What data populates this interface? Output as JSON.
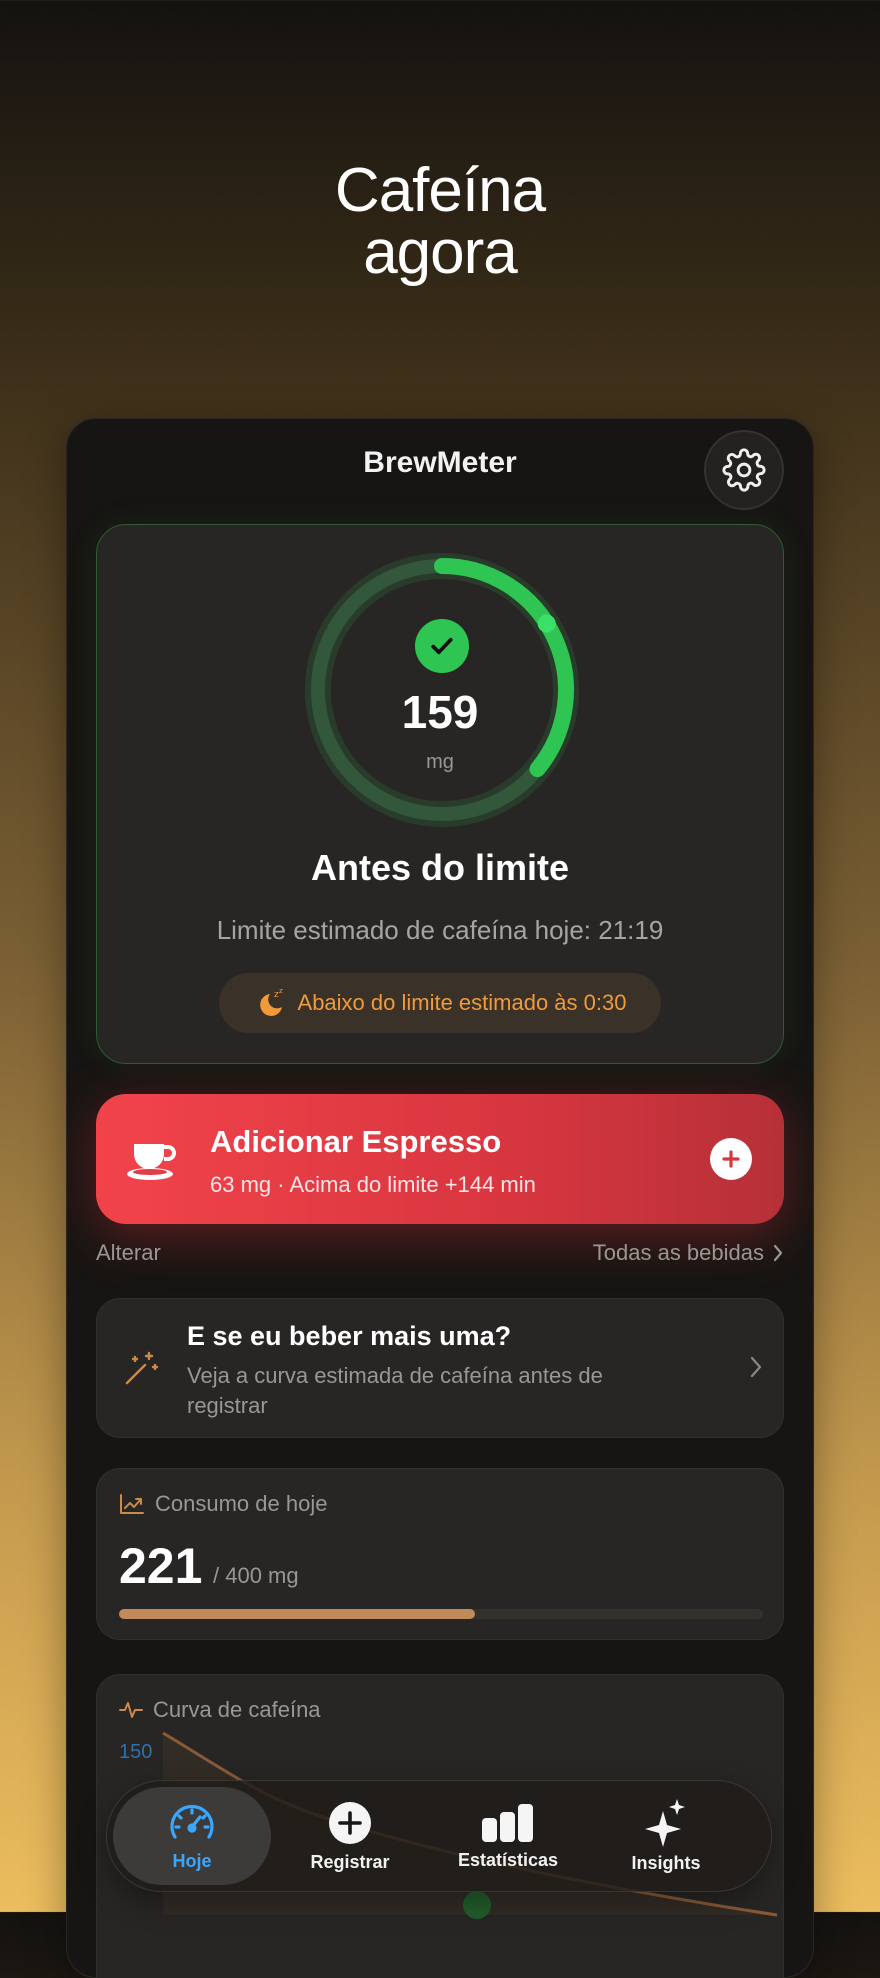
{
  "headline": {
    "line1": "Cafeína",
    "line2": "agora"
  },
  "app": {
    "title": "BrewMeter",
    "settings_icon": "gear-icon"
  },
  "status": {
    "value": "159",
    "unit": "mg",
    "ring_progress": 0.36,
    "ring_color": "#2fc552",
    "title": "Antes do limite",
    "subtitle": "Limite estimado de cafeína hoje: 21:19",
    "sleep_note": "Abaixo do limite estimado às 0:30",
    "sleep_color": "#f09a3a"
  },
  "quick_add": {
    "title": "Adicionar Espresso",
    "subtitle": "63 mg · Acima do limite +144 min",
    "accent": "#f2434b"
  },
  "links": {
    "change": "Alterar",
    "all_drinks": "Todas as bebidas"
  },
  "what_if": {
    "title": "E se eu beber mais uma?",
    "subtitle": "Veja a curva estimada de cafeína antes de registrar"
  },
  "today": {
    "label": "Consumo de hoje",
    "value": "221",
    "limit": "/ 400 mg",
    "fraction": 0.5525
  },
  "curve": {
    "label": "Curva de cafeína",
    "tick": "150"
  },
  "tabs": [
    {
      "label": "Hoje",
      "icon": "speedometer-icon",
      "active": true
    },
    {
      "label": "Registrar",
      "icon": "plus-circle-icon",
      "active": false
    },
    {
      "label": "Estatísticas",
      "icon": "bar-chart-icon",
      "active": false
    },
    {
      "label": "Insights",
      "icon": "sparkles-icon",
      "active": false
    }
  ]
}
